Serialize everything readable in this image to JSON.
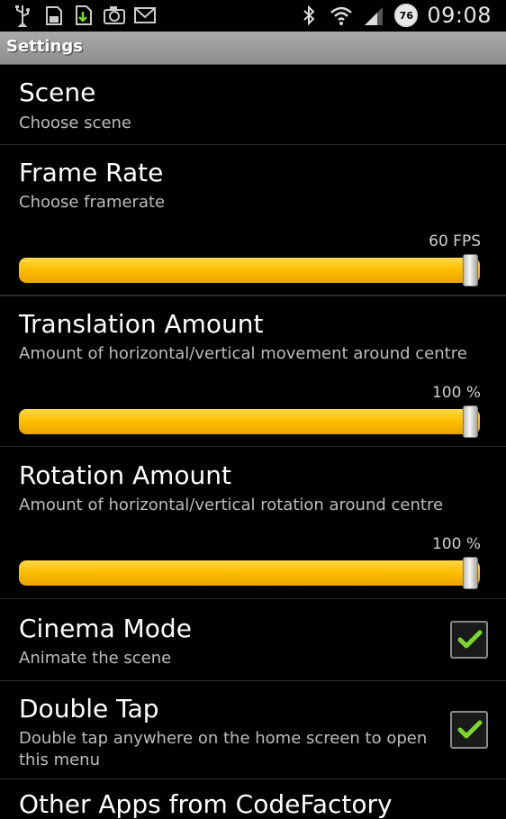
{
  "status_bar": {
    "left_icons": [
      "usb-icon",
      "sd-card-icon",
      "download-icon",
      "camera-icon",
      "mail-icon"
    ],
    "right_icons": [
      "bluetooth-icon",
      "wifi-icon",
      "signal-icon"
    ],
    "battery_level": "76",
    "time": "09:08"
  },
  "title_bar": {
    "title": "Settings"
  },
  "colors": {
    "accent": "#FFBF00",
    "check": "#7CD62B",
    "title_bar": "#9A9A9A"
  },
  "prefs": {
    "scene": {
      "title": "Scene",
      "summary": "Choose scene"
    },
    "frame_rate": {
      "title": "Frame Rate",
      "summary": "Choose framerate",
      "value_label": "60 FPS",
      "fraction": 1.0
    },
    "translation": {
      "title": "Translation Amount",
      "summary": "Amount of horizontal/vertical movement around centre",
      "value_label": "100 %",
      "fraction": 1.0
    },
    "rotation": {
      "title": "Rotation Amount",
      "summary": "Amount of horizontal/vertical rotation around centre",
      "value_label": "100 %",
      "fraction": 1.0
    },
    "cinema": {
      "title": "Cinema Mode",
      "summary": "Animate the scene",
      "checked": true
    },
    "double_tap": {
      "title": "Double Tap",
      "summary_line1": "Double tap anywhere on the home screen to open",
      "summary_line2": "this menu",
      "checked": true
    },
    "other_apps": {
      "title": "Other Apps from CodeFactory"
    }
  }
}
